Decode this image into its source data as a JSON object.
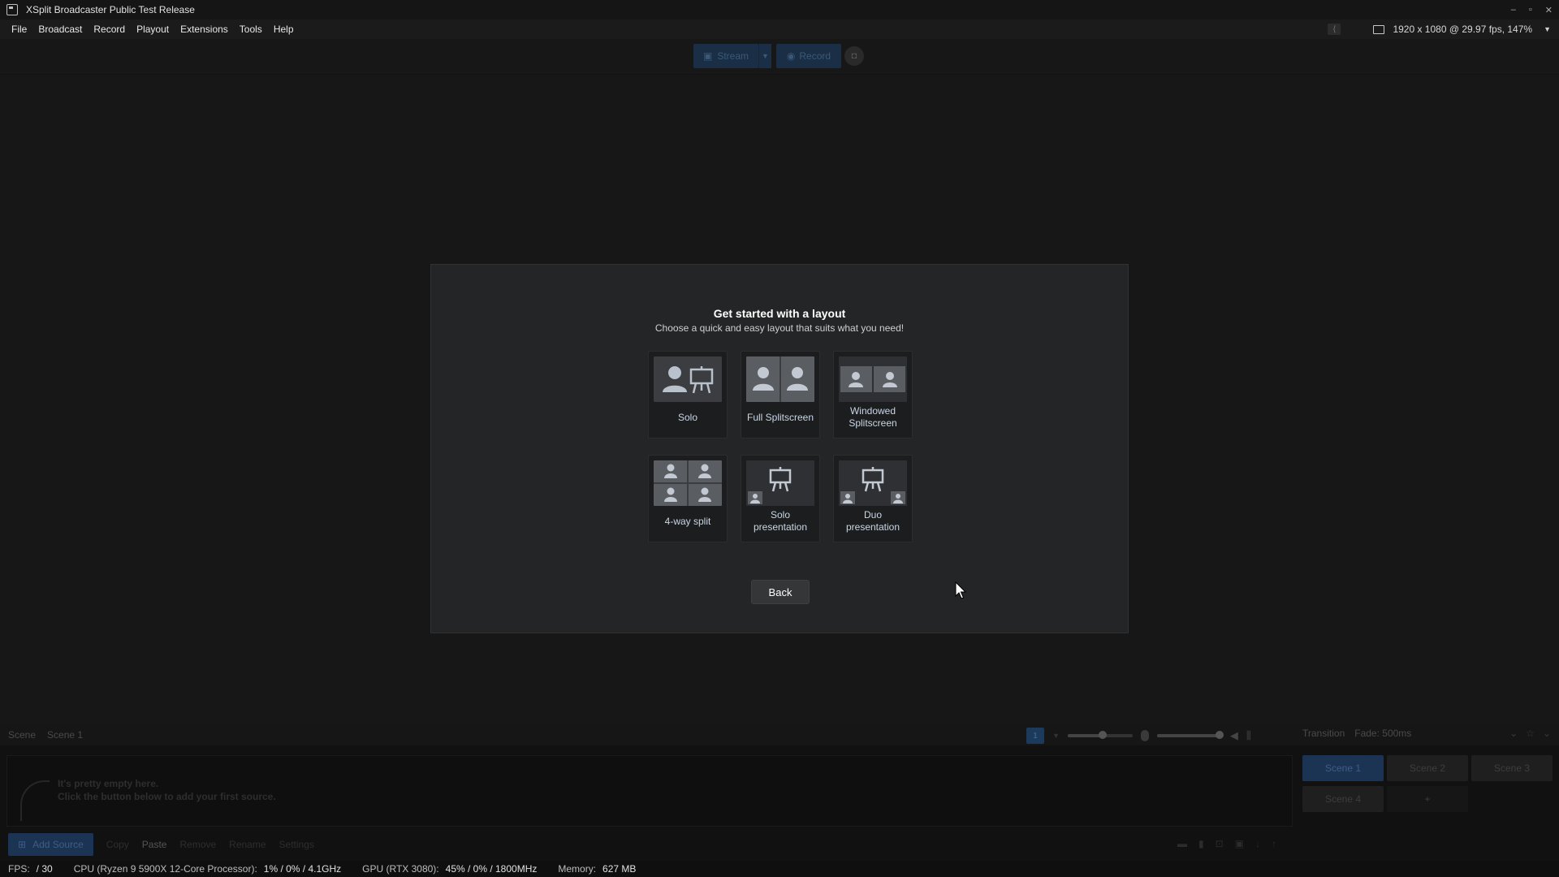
{
  "window": {
    "title": "XSplit Broadcaster Public Test Release",
    "controls": [
      "–",
      "▫",
      "✕"
    ]
  },
  "menu": {
    "items": [
      "File",
      "Broadcast",
      "Record",
      "Playout",
      "Extensions",
      "Tools",
      "Help"
    ],
    "resolution_info": "1920 x 1080 @ 29.97 fps, 147%"
  },
  "toolbar": {
    "stream_label": "Stream",
    "record_label": "Record"
  },
  "modal": {
    "title": "Get started with a layout",
    "subtitle": "Choose a quick and easy layout that suits what you need!",
    "tiles": [
      {
        "label": "Solo",
        "icon": "solo-layout-icon"
      },
      {
        "label": "Full Splitscreen",
        "icon": "full-splitscreen-icon"
      },
      {
        "label": "Windowed Splitscreen",
        "label_line1": "Windowed",
        "label_line2": "Splitscreen",
        "icon": "windowed-splitscreen-icon"
      },
      {
        "label": "4-way split",
        "icon": "four-way-split-icon"
      },
      {
        "label": "Solo presentation",
        "label_line1": "Solo",
        "label_line2": "presentation",
        "icon": "solo-presentation-icon"
      },
      {
        "label": "Duo presentation",
        "label_line1": "Duo",
        "label_line2": "presentation",
        "icon": "duo-presentation-icon"
      }
    ],
    "back_label": "Back"
  },
  "scene_bar": {
    "scene_label": "Scene",
    "scene_name": "Scene 1",
    "scene_number": "1",
    "transition_label": "Transition",
    "transition_value": "Fade: 500ms"
  },
  "sources": {
    "empty_line1": "It's pretty empty here.",
    "empty_line2": "Click the button below to add your first source.",
    "actions": {
      "add": "Add Source",
      "copy": "Copy",
      "paste": "Paste",
      "remove": "Remove",
      "rename": "Rename",
      "settings": "Settings"
    }
  },
  "scenes": {
    "tiles": [
      "Scene 1",
      "Scene 2",
      "Scene 3",
      "Scene 4"
    ],
    "add_label": "+"
  },
  "status": {
    "fps_label": "FPS:",
    "fps_value": "/ 30",
    "cpu_label": "CPU (Ryzen 9 5900X 12-Core Processor):",
    "cpu_value": "1% / 0% / 4.1GHz",
    "gpu_label": "GPU (RTX 3080):",
    "gpu_value": "45% / 0% / 1800MHz",
    "mem_label": "Memory:",
    "mem_value": "627 MB"
  },
  "colors": {
    "accent": "#1c3454",
    "modal_bg": "#242526",
    "tile_label": "#c9d6e6"
  }
}
